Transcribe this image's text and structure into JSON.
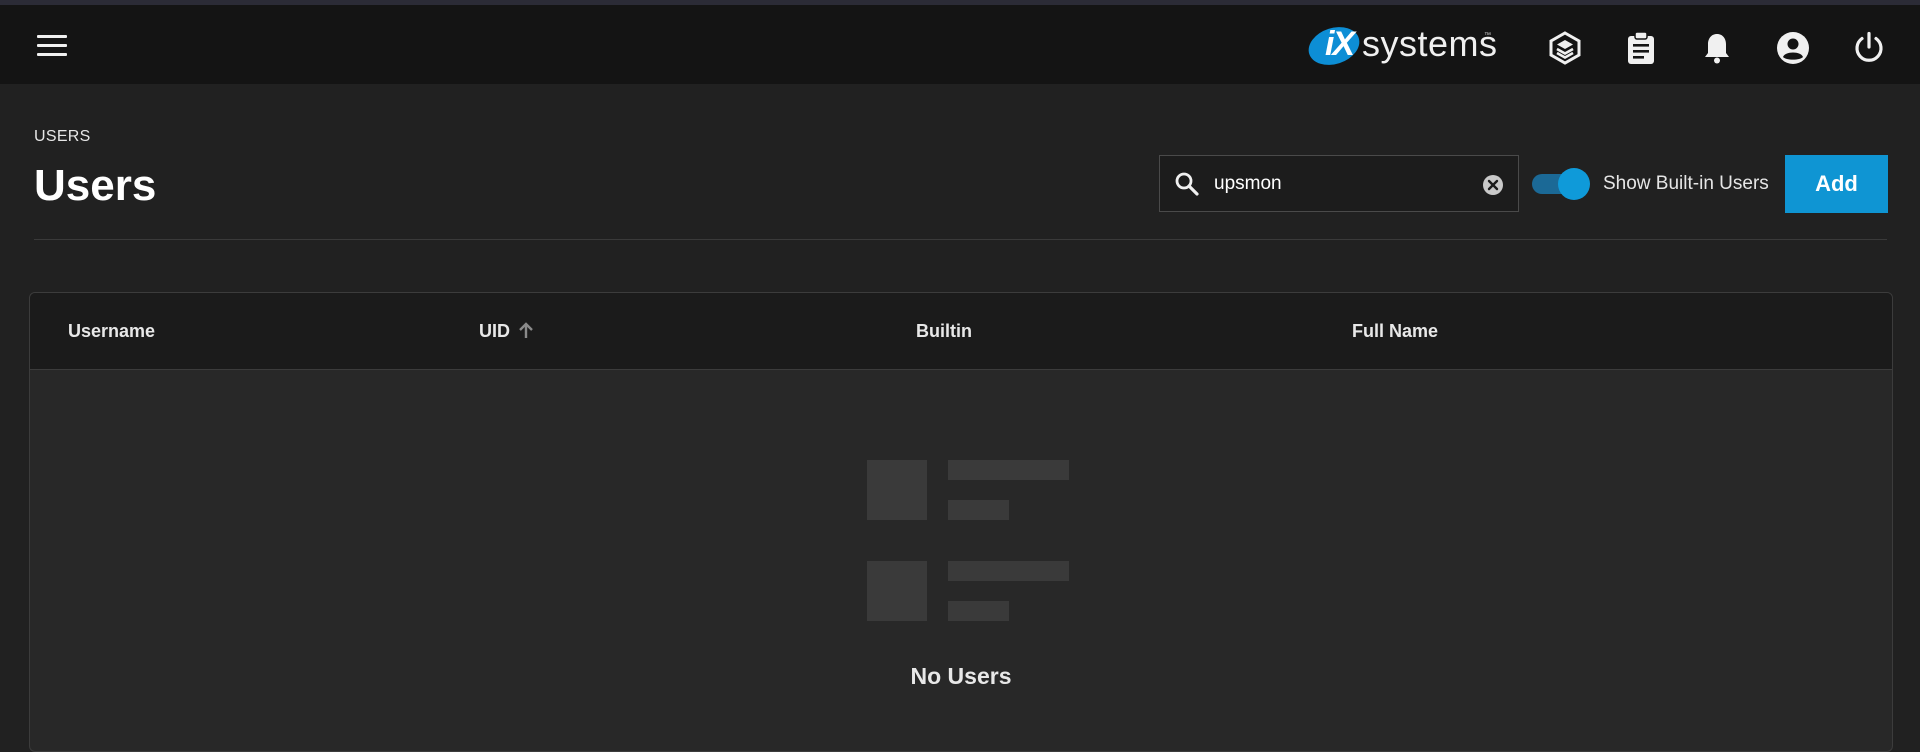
{
  "app": {
    "brand_mark": "iX",
    "brand_word": "systems",
    "brand_tm": "™",
    "brand_color": "#0d8ed5"
  },
  "topbar_icons": [
    "menu-icon",
    "truecommand-icon",
    "clipboard-icon",
    "bell-icon",
    "account-circle-icon",
    "power-icon"
  ],
  "page": {
    "breadcrumb": "USERS",
    "title": "Users"
  },
  "search": {
    "value": "upsmon",
    "placeholder": ""
  },
  "toggle": {
    "label": "Show Built-in Users",
    "on": true
  },
  "actions": {
    "add_label": "Add",
    "accent_color": "#0f95d3"
  },
  "table": {
    "columns": [
      {
        "label": "Username"
      },
      {
        "label": "UID",
        "sort": "ascending"
      },
      {
        "label": "Builtin"
      },
      {
        "label": "Full Name"
      }
    ],
    "empty_message": "No Users"
  }
}
